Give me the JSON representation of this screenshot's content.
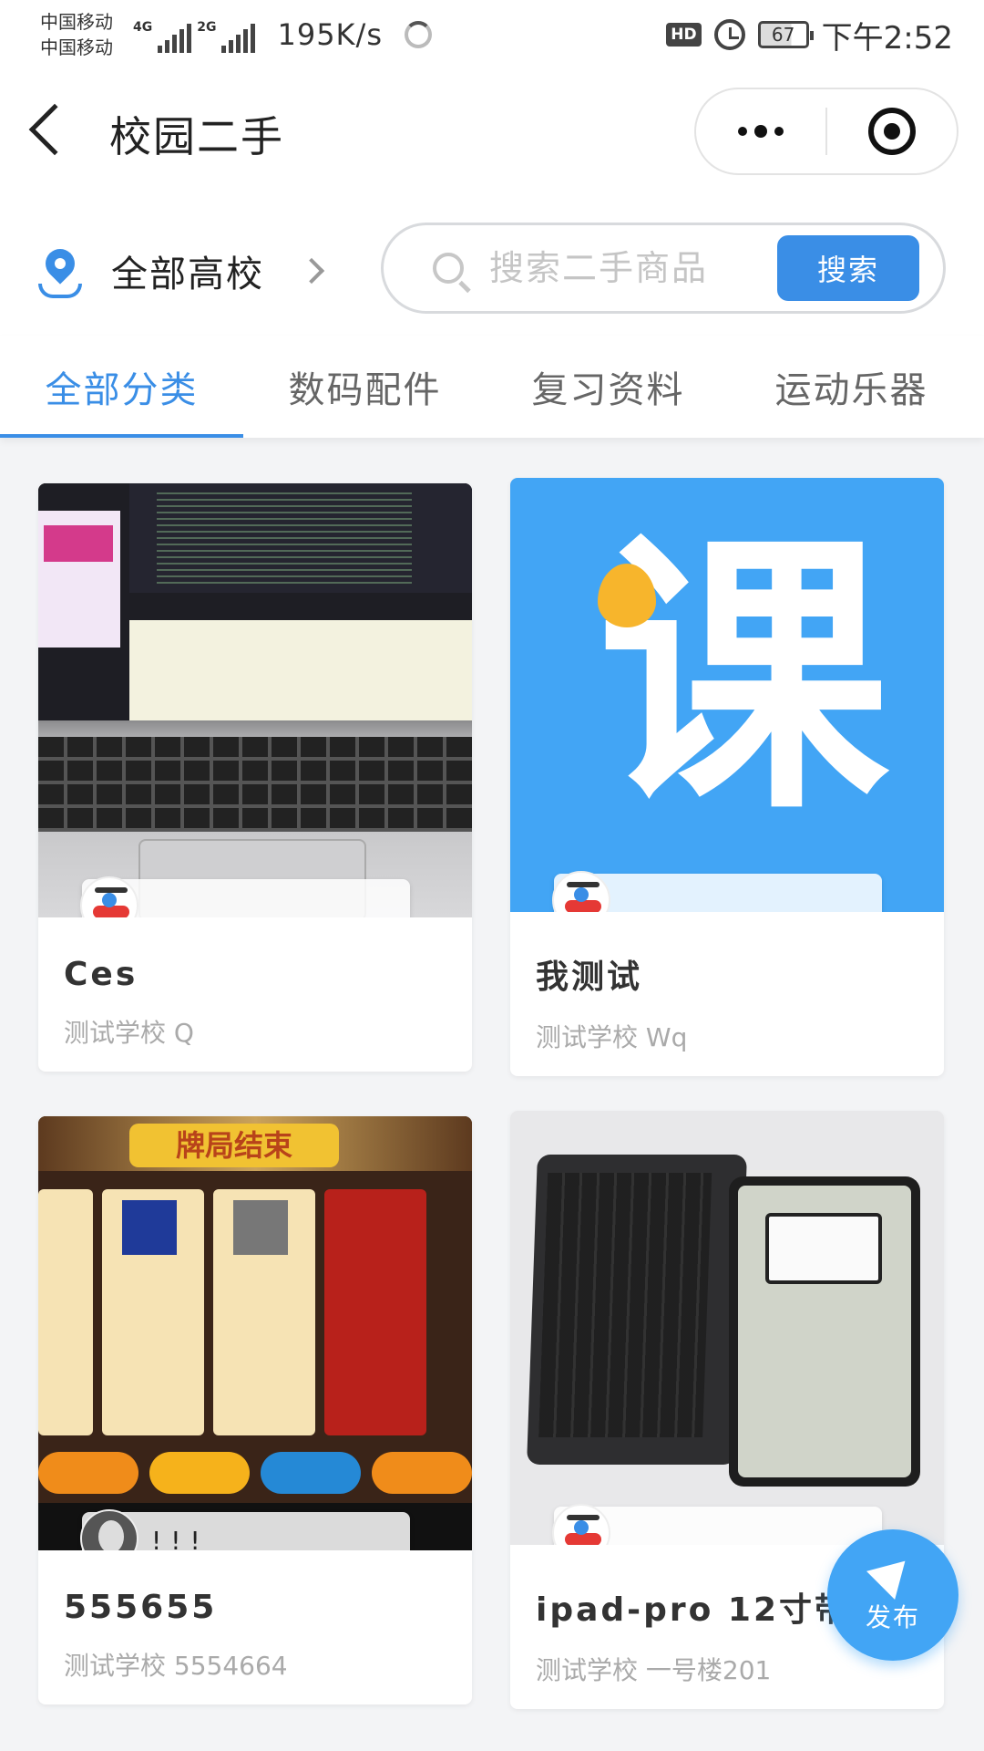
{
  "status_bar": {
    "carrier_1": "中国移动",
    "carrier_2": "中国移动",
    "net_1": "4G",
    "net_2": "2G",
    "speed": "195K/s",
    "hd": "HD",
    "battery": "67",
    "time": "下午2:52"
  },
  "navbar": {
    "title": "校园二手"
  },
  "filter": {
    "location_label": "全部高校",
    "search_placeholder": "搜索二手商品",
    "search_button": "搜索"
  },
  "tabs": [
    {
      "label": "全部分类",
      "active": true
    },
    {
      "label": "数码配件",
      "active": false
    },
    {
      "label": "复习资料",
      "active": false
    },
    {
      "label": "运动乐器",
      "active": false
    }
  ],
  "products": [
    {
      "title": "Ces",
      "subtitle": "测试学校 Q",
      "user_text": ""
    },
    {
      "title": "我测试",
      "subtitle": "测试学校 Wq",
      "user_text": ""
    },
    {
      "title": "555655",
      "subtitle": "测试学校 5554664",
      "user_text": "!!!"
    },
    {
      "title": "ipad-pro 12寸带键盘",
      "subtitle": "测试学校 一号楼201",
      "user_text": ""
    }
  ],
  "image_text": {
    "logo_char": "课",
    "game_banner": "牌局结束"
  },
  "fab": {
    "label": "发布"
  },
  "colors": {
    "accent": "#3a8ee6",
    "fab": "#42a5f5",
    "logo_dot": "#f7b52c"
  }
}
